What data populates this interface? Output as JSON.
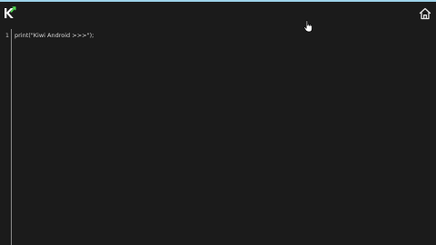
{
  "app": {
    "logo_icon": "kiwi-logo-icon",
    "home_icon": "home-icon"
  },
  "editor": {
    "lines": [
      {
        "number": "1",
        "code": "print(\"Kiwi Android >>>\");"
      }
    ]
  },
  "colors": {
    "background": "#1b1b1b",
    "accent_bar": "#9dd2e8",
    "logo_green": "#4cd44c",
    "text": "#d8d8d8",
    "gutter": "#8a8a8a"
  }
}
